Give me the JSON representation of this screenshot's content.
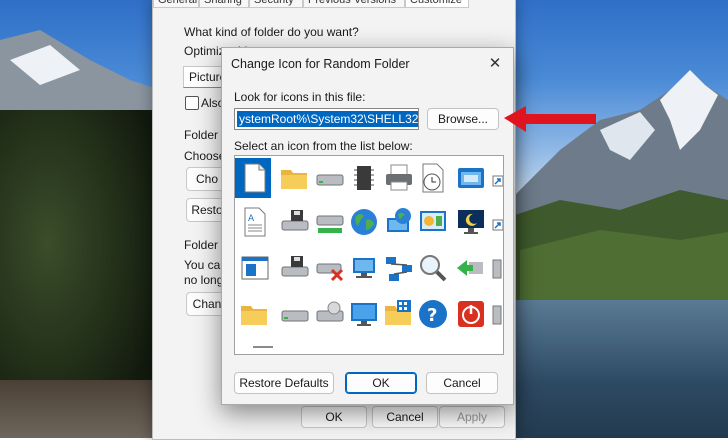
{
  "background_window": {
    "tabs": [
      "General",
      "Sharing",
      "Security",
      "Previous Versions",
      "Customize"
    ],
    "folder_kind_title": "What kind of folder do you want?",
    "optimize_label": "Optimize this folder for:",
    "optimize_value": "Pictures",
    "also_apply_label": "Also",
    "folder_pictures_title": "Folder p",
    "choose_label": "Choose",
    "choose_file_btn": "Cho",
    "restore_btn": "Resto",
    "folder_icons_title": "Folder ic",
    "you_can_label": "You can",
    "no_longer_label": "no longe",
    "change_icon_btn": "Chan",
    "ok_btn": "OK",
    "cancel_btn": "Cancel",
    "apply_btn": "Apply"
  },
  "dialog": {
    "title": "Change Icon for Random Folder",
    "close_glyph": "✕",
    "look_for_label": "Look for icons in this file:",
    "path_value": "ystemRoot%\\System32\\SHELL32.dll",
    "browse_btn": "Browse...",
    "select_label": "Select an icon from the list below:",
    "restore_defaults_btn": "Restore Defaults",
    "ok_btn": "OK",
    "cancel_btn": "Cancel",
    "icons": [
      [
        "blank-document-icon",
        "folder-icon",
        "drive-icon",
        "chip-icon",
        "printer-icon",
        "clock-document-icon",
        "window-icon",
        "shortcut-icon"
      ],
      [
        "text-document-icon",
        "drive-floppy-icon",
        "network-drive-icon",
        "globe-icon",
        "network-globe-icon",
        "control-panel-icon",
        "moon-monitor-icon",
        "shortcut-icon"
      ],
      [
        "application-window-icon",
        "drive-floppy-icon",
        "disconnected-drive-icon",
        "network-computer-icon",
        "network-icon",
        "magnifier-icon",
        "usb-icon",
        "partial-icon"
      ],
      [
        "folder-icon",
        "drive-icon",
        "drive-disc-icon",
        "monitor-icon",
        "folder-grid-icon",
        "help-icon",
        "power-icon",
        "partial-icon"
      ]
    ]
  },
  "colors": {
    "accent": "#0067c0",
    "arrow": "#e0141e"
  }
}
